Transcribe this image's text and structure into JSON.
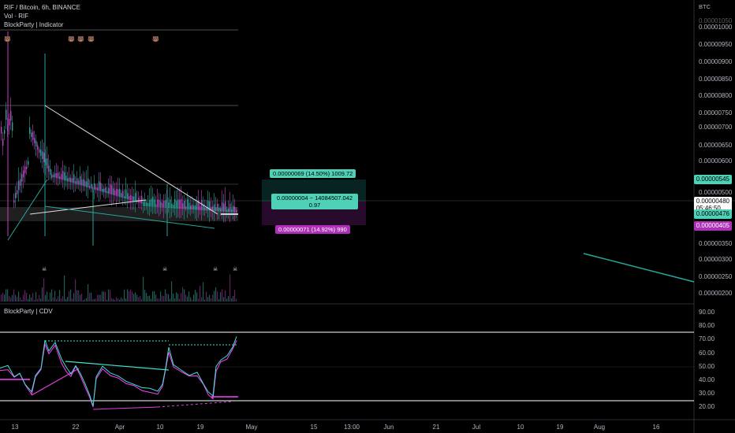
{
  "header": {
    "symbol_line": "RIF / Bitcoin, 6h, BINANCE",
    "volume_line": "Vol · RIF",
    "indicator_line": "BlockParty | Indicator",
    "currency": "BTC"
  },
  "sub_pane": {
    "title": "BlockParty | CDV"
  },
  "price_axis": {
    "labels": [
      "0.00001050",
      "0.00001000",
      "0.00000950",
      "0.00000900",
      "0.00000850",
      "0.00000800",
      "0.00000750",
      "0.00000700",
      "0.00000650",
      "0.00000600",
      "0.00000550",
      "0.00000500",
      "0.00000450",
      "0.00000400",
      "0.00000350",
      "0.00000300",
      "0.00000250",
      "0.00000200"
    ],
    "tags": {
      "upper": "0.00000545",
      "last": "0.00000480",
      "countdown": "05:46:50",
      "mid": "0.00000476",
      "lower": "0.00000405"
    }
  },
  "cdv_axis": {
    "labels": [
      "90.00",
      "80.00",
      "70.00",
      "60.00",
      "50.00",
      "40.00",
      "30.00",
      "20.00"
    ]
  },
  "time_axis": {
    "labels": [
      "13",
      "22",
      "Apr",
      "10",
      "19",
      "May",
      "15",
      "13:00",
      "Jun",
      "21",
      "Jul",
      "10",
      "19",
      "Aug",
      "16"
    ]
  },
  "range_tool": {
    "top_label": "0.00000069 (14.50%) 1009.72",
    "mid_label_line1": "0.00000004 − 14084507.042",
    "mid_label_line2": "0.97",
    "bottom_label": "0.00000071 (14.92%) 990"
  },
  "colors": {
    "background": "#000000",
    "teal": "#26a69a",
    "magenta": "#c83cc8",
    "pink": "#ff40ff",
    "cyan": "#40e0d0",
    "white": "#ffffff",
    "tag_teal": "#4fd1b8",
    "tag_magenta": "#b02fb8"
  },
  "icons": {
    "bear": "bear-face-icon",
    "skull": "skull-icon"
  }
}
